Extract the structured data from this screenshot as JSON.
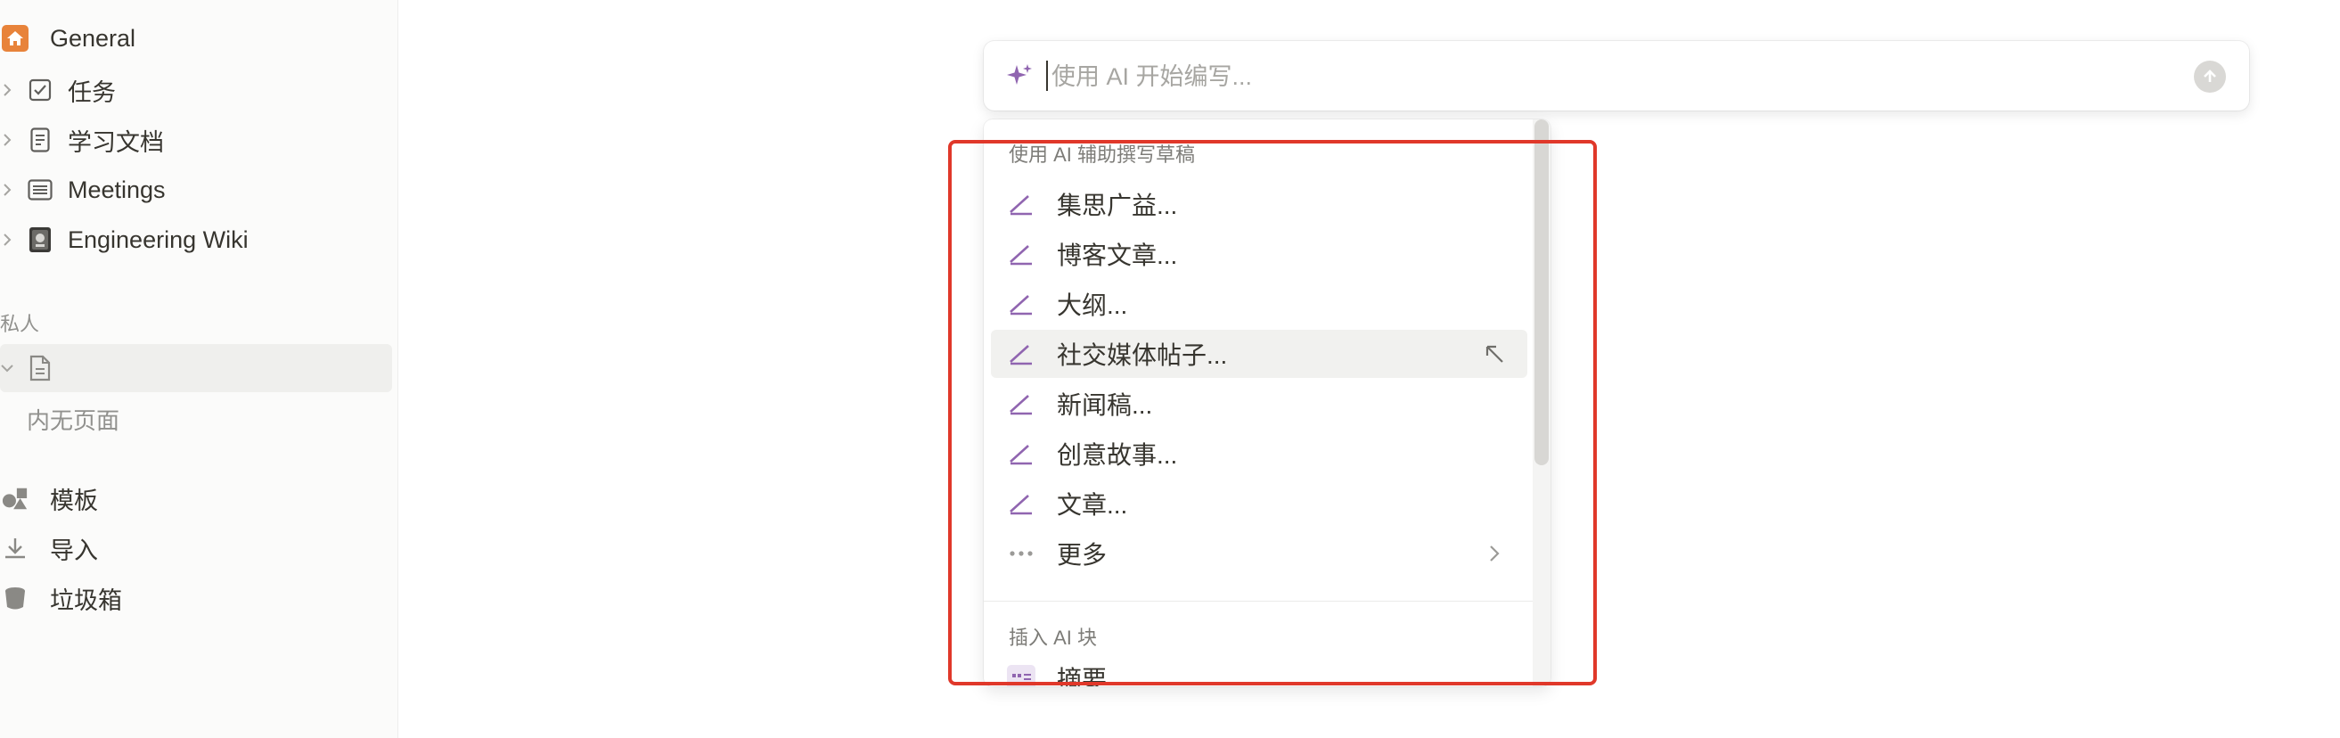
{
  "sidebar": {
    "workspace": {
      "label": "General",
      "icon": "home-icon"
    },
    "pages": [
      {
        "label": "任务",
        "icon": "checkbox-icon"
      },
      {
        "label": "学习文档",
        "icon": "document-icon"
      },
      {
        "label": "Meetings",
        "icon": "notes-icon"
      },
      {
        "label": "Engineering Wiki",
        "icon": "book-icon"
      }
    ],
    "private_section_label": "私人",
    "private_page": {
      "icon": "blank-page-icon"
    },
    "empty_text": "内无页面",
    "bottom": [
      {
        "label": "模板",
        "icon": "templates-icon"
      },
      {
        "label": "导入",
        "icon": "import-icon"
      },
      {
        "label": "垃圾箱",
        "icon": "trash-icon"
      }
    ]
  },
  "ai_prompt": {
    "placeholder": "使用 AI 开始编写...",
    "value": "",
    "icons": {
      "leading": "sparkle-icon",
      "send": "send-arrow-icon"
    },
    "accent_color": "#9065b0"
  },
  "menu": {
    "draft_group_label": "使用 AI 辅助撰写草稿",
    "draft_items": [
      {
        "label": "集思广益..."
      },
      {
        "label": "博客文章..."
      },
      {
        "label": "大纲..."
      },
      {
        "label": "社交媒体帖子...",
        "highlighted": true
      },
      {
        "label": "新闻稿..."
      },
      {
        "label": "创意故事..."
      },
      {
        "label": "文章..."
      }
    ],
    "more_label": "更多",
    "insert_group_label": "插入 AI 块",
    "insert_items": [
      {
        "label": "摘要",
        "icon": "quote-list-icon"
      }
    ]
  },
  "colors": {
    "highlight_border": "#e0382a",
    "home_icon": "#e8833a",
    "ai_purple": "#9065b0"
  }
}
